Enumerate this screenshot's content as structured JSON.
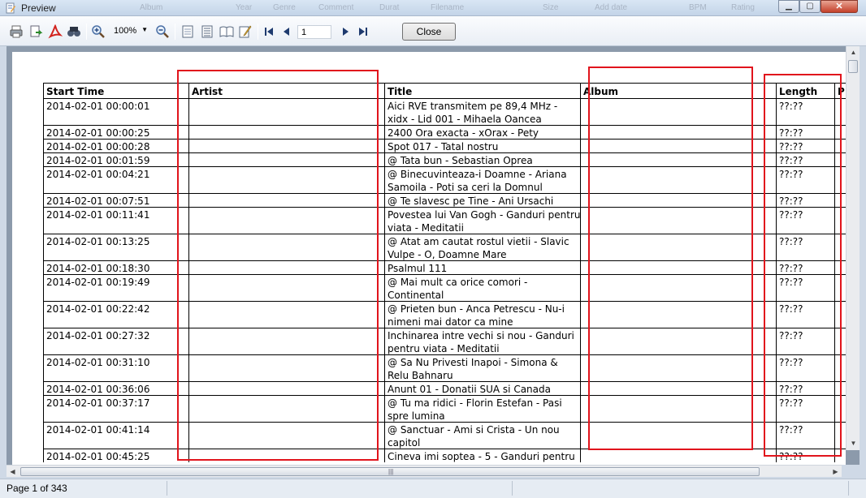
{
  "window": {
    "title": "Preview",
    "background_menu_ghosts": [
      "Album",
      "Year",
      "Genre",
      "Comment",
      "Durat",
      "Filename",
      "Size",
      "Add date",
      "BPM",
      "Rating"
    ]
  },
  "toolbar": {
    "zoom_value": "100%",
    "page_value": "1",
    "close_label": "Close"
  },
  "table": {
    "headers": [
      "Start Time",
      "Artist",
      "Title",
      "Album",
      "Length",
      "P"
    ],
    "rows": [
      {
        "start": "2014-02-01 00:00:01",
        "artist": "",
        "title": [
          "Aici RVE transmitem pe 89,4 MHz -",
          "xidx - Lid 001 - Mihaela Oancea"
        ],
        "album": "",
        "length": "??:??"
      },
      {
        "start": "2014-02-01 00:00:25",
        "artist": "",
        "title": [
          "2400 Ora exacta - xOrax - Pety"
        ],
        "album": "",
        "length": "??:??"
      },
      {
        "start": "2014-02-01 00:00:28",
        "artist": "",
        "title": [
          "Spot 017 - Tatal nostru"
        ],
        "album": "",
        "length": "??:??"
      },
      {
        "start": "2014-02-01 00:01:59",
        "artist": "",
        "title": [
          "@ Tata bun - Sebastian Oprea"
        ],
        "album": "",
        "length": "??:??"
      },
      {
        "start": "2014-02-01 00:04:21",
        "artist": "",
        "title": [
          "@ Binecuvinteaza-i Doamne - Ariana",
          "Samoila - Poti sa ceri la Domnul"
        ],
        "album": "",
        "length": "??:??"
      },
      {
        "start": "2014-02-01 00:07:51",
        "artist": "",
        "title": [
          "@ Te slavesc pe Tine - Ani Ursachi"
        ],
        "album": "",
        "length": "??:??"
      },
      {
        "start": "2014-02-01 00:11:41",
        "artist": "",
        "title": [
          "Povestea lui Van Gogh - Ganduri pentru",
          "viata - Meditatii"
        ],
        "album": "",
        "length": "??:??"
      },
      {
        "start": "2014-02-01 00:13:25",
        "artist": "",
        "title": [
          "@ Atat am cautat rostul vietii - Slavic",
          "Vulpe - O, Doamne Mare"
        ],
        "album": "",
        "length": "??:??"
      },
      {
        "start": "2014-02-01 00:18:30",
        "artist": "",
        "title": [
          "Psalmul 111"
        ],
        "album": "",
        "length": "??:??"
      },
      {
        "start": "2014-02-01 00:19:49",
        "artist": "",
        "title": [
          "@ Mai mult ca orice comori -",
          "Continental"
        ],
        "album": "",
        "length": "??:??"
      },
      {
        "start": "2014-02-01 00:22:42",
        "artist": "",
        "title": [
          "@ Prieten bun - Anca Petrescu - Nu-i",
          "nimeni mai dator ca mine"
        ],
        "album": "",
        "length": "??:??"
      },
      {
        "start": "2014-02-01 00:27:32",
        "artist": "",
        "title": [
          "Inchinarea intre vechi si nou - Ganduri",
          "pentru viata - Meditatii"
        ],
        "album": "",
        "length": "??:??"
      },
      {
        "start": "2014-02-01 00:31:10",
        "artist": "",
        "title": [
          "@ Sa Nu Privesti Inapoi - Simona &",
          "Relu Bahnaru"
        ],
        "album": "",
        "length": "??:??"
      },
      {
        "start": "2014-02-01 00:36:06",
        "artist": "",
        "title": [
          "Anunt 01 - Donatii SUA si Canada"
        ],
        "album": "",
        "length": "??:??"
      },
      {
        "start": "2014-02-01 00:37:17",
        "artist": "",
        "title": [
          "@ Tu ma ridici - Florin Estefan - Pasi",
          "spre lumina"
        ],
        "album": "",
        "length": "??:??"
      },
      {
        "start": "2014-02-01 00:41:14",
        "artist": "",
        "title": [
          "@ Sanctuar - Ami si Crista - Un nou",
          "capitol"
        ],
        "album": "",
        "length": "??:??"
      },
      {
        "start": "2014-02-01 00:45:25",
        "artist": "",
        "title": [
          "Cineva imi soptea - 5 - Ganduri pentru"
        ],
        "album": "",
        "length": "??:??"
      }
    ]
  },
  "status": {
    "page_text": "Page 1 of 343"
  },
  "colors": {
    "annotation_red": "#e1141c",
    "doc_background": "#8c9aab"
  }
}
